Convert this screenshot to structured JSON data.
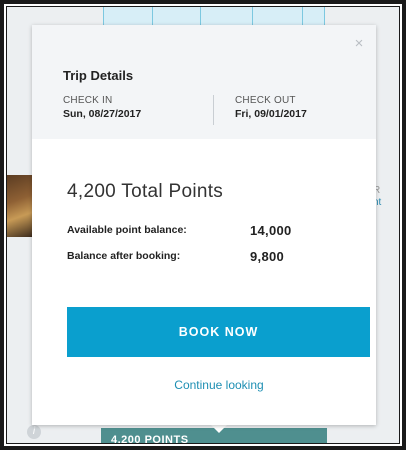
{
  "modal": {
    "title": "Trip Details",
    "close_glyph": "×",
    "check_in": {
      "label": "CHECK IN",
      "value": "Sun, 08/27/2017"
    },
    "check_out": {
      "label": "CHECK OUT",
      "value": "Fri, 09/01/2017"
    },
    "total_points": "4,200 Total Points",
    "available_label": "Available point balance:",
    "available_value": "14,000",
    "after_label": "Balance after booking:",
    "after_value": "9,800",
    "book_button": "BOOK NOW",
    "continue_link": "Continue looking"
  },
  "background": {
    "points_badge": "4,200 POINTS",
    "right_text_1": "R",
    "right_text_2": "nt",
    "info_glyph": "i"
  },
  "colors": {
    "accent": "#0a9fce",
    "link": "#1e8fb3",
    "badge": "#4f8f8f"
  }
}
